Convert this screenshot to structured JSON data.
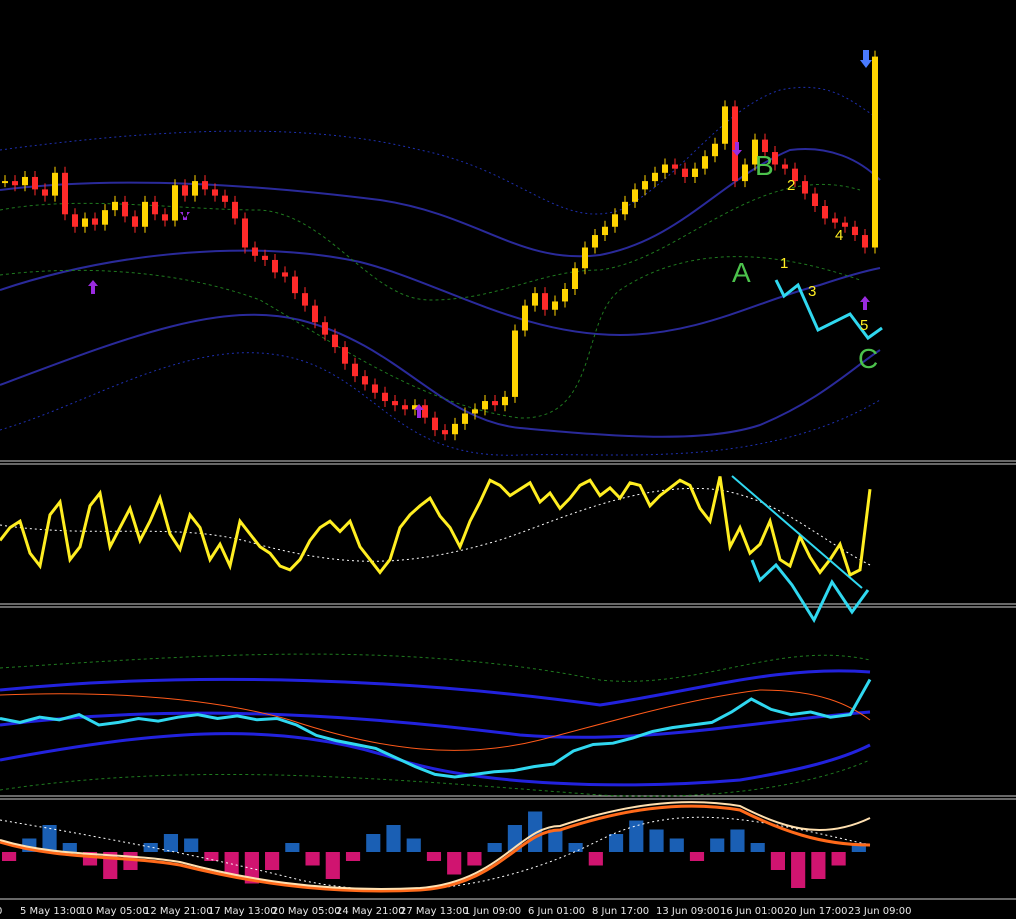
{
  "chart_data": [
    {
      "type": "candlestick",
      "panel": "price",
      "annotations": {
        "wave_letters": [
          "A",
          "B",
          "C"
        ],
        "wave_numbers": [
          "1",
          "2",
          "3",
          "4",
          "5"
        ]
      },
      "series": [
        {
          "name": "candles_close",
          "x": [
            0,
            10,
            20,
            30,
            40,
            50,
            60,
            70,
            80,
            90,
            100,
            110,
            120,
            130,
            140,
            150,
            160,
            170,
            180,
            190,
            200,
            210,
            220,
            230,
            240,
            250,
            260,
            270,
            280,
            290,
            300,
            310,
            320,
            330,
            340,
            350,
            360,
            370,
            380,
            390,
            400,
            410,
            420,
            430,
            440,
            450,
            460,
            470,
            480,
            490,
            500,
            510,
            520,
            530,
            540,
            550,
            560,
            570,
            580,
            590,
            600,
            610,
            620,
            630,
            640,
            650,
            660,
            670,
            680,
            690,
            700,
            710,
            720,
            730,
            740,
            750,
            760,
            770,
            780,
            790,
            800,
            810,
            820,
            830,
            840,
            850,
            860,
            870
          ],
          "y": [
            0.62,
            0.6,
            0.64,
            0.58,
            0.55,
            0.66,
            0.46,
            0.4,
            0.44,
            0.41,
            0.48,
            0.52,
            0.45,
            0.4,
            0.52,
            0.46,
            0.43,
            0.6,
            0.55,
            0.62,
            0.58,
            0.55,
            0.52,
            0.44,
            0.3,
            0.26,
            0.24,
            0.18,
            0.16,
            0.08,
            0.02,
            -0.06,
            -0.12,
            -0.18,
            -0.26,
            -0.32,
            -0.36,
            -0.4,
            -0.44,
            -0.46,
            -0.48,
            -0.46,
            -0.52,
            -0.58,
            -0.6,
            -0.55,
            -0.5,
            -0.48,
            -0.44,
            -0.46,
            -0.42,
            -0.1,
            0.02,
            0.08,
            0.0,
            0.04,
            0.1,
            0.2,
            0.3,
            0.36,
            0.4,
            0.46,
            0.52,
            0.58,
            0.62,
            0.66,
            0.7,
            0.68,
            0.64,
            0.68,
            0.74,
            0.8,
            0.98,
            0.62,
            0.7,
            0.82,
            0.76,
            0.7,
            0.68,
            0.62,
            0.56,
            0.5,
            0.44,
            0.42,
            0.4,
            0.36,
            0.3,
            1.22
          ]
        }
      ]
    },
    {
      "type": "line",
      "panel": "oscillator_1",
      "series": [
        {
          "name": "yellow",
          "y": [
            0.45,
            0.55,
            0.6,
            0.35,
            0.25,
            0.65,
            0.75,
            0.3,
            0.4,
            0.72,
            0.82,
            0.4,
            0.55,
            0.7,
            0.45,
            0.6,
            0.78,
            0.5,
            0.38,
            0.65,
            0.55,
            0.3,
            0.42,
            0.25,
            0.6,
            0.5,
            0.4,
            0.35,
            0.25,
            0.22,
            0.3,
            0.45,
            0.55,
            0.6,
            0.52,
            0.6,
            0.4,
            0.3,
            0.2,
            0.3,
            0.55,
            0.65,
            0.72,
            0.78,
            0.64,
            0.55,
            0.4,
            0.6,
            0.75,
            0.92,
            0.88,
            0.8,
            0.85,
            0.9,
            0.75,
            0.82,
            0.7,
            0.78,
            0.88,
            0.92,
            0.8,
            0.86,
            0.78,
            0.9,
            0.88,
            0.72,
            0.8,
            0.86,
            0.92,
            0.88,
            0.7,
            0.6,
            0.95,
            0.4,
            0.55,
            0.35,
            0.42,
            0.6,
            0.3,
            0.25,
            0.48,
            0.32,
            0.2,
            0.3,
            0.42,
            0.18,
            0.22,
            0.85
          ]
        }
      ]
    },
    {
      "type": "line",
      "panel": "oscillator_2",
      "series": [
        {
          "name": "cyan",
          "y": [
            0.55,
            0.52,
            0.56,
            0.54,
            0.58,
            0.5,
            0.52,
            0.55,
            0.53,
            0.56,
            0.58,
            0.55,
            0.57,
            0.54,
            0.55,
            0.5,
            0.42,
            0.38,
            0.35,
            0.32,
            0.25,
            0.18,
            0.12,
            0.1,
            0.12,
            0.14,
            0.15,
            0.18,
            0.2,
            0.3,
            0.35,
            0.36,
            0.4,
            0.45,
            0.48,
            0.5,
            0.52,
            0.6,
            0.7,
            0.62,
            0.58,
            0.6,
            0.56,
            0.58,
            0.85
          ]
        }
      ]
    },
    {
      "type": "bar",
      "panel": "histogram",
      "series": [
        {
          "name": "histogram",
          "values": [
            -0.2,
            0.3,
            0.6,
            0.2,
            -0.3,
            -0.6,
            -0.4,
            0.2,
            0.4,
            0.3,
            -0.2,
            -0.5,
            -0.7,
            -0.4,
            0.2,
            -0.3,
            -0.6,
            -0.2,
            0.4,
            0.6,
            0.3,
            -0.2,
            -0.5,
            -0.3,
            0.2,
            0.6,
            0.9,
            0.5,
            0.2,
            -0.3,
            0.4,
            0.7,
            0.5,
            0.3,
            -0.2,
            0.3,
            0.5,
            0.2,
            -0.4,
            -0.8,
            -0.6,
            -0.3,
            0.2
          ]
        }
      ]
    }
  ],
  "x_axis": {
    "labels": [
      "0",
      "5 May 13:00",
      "10 May 05:00",
      "12 May 21:00",
      "17 May 13:00",
      "20 May 05:00",
      "24 May 21:00",
      "27 May 13:00",
      "1 Jun 09:00",
      "6 Jun 01:00",
      "8 Jun 17:00",
      "13 Jun 09:00",
      "16 Jun 01:00",
      "20 Jun 17:00",
      "23 Jun 09:00"
    ]
  },
  "colors": {
    "background": "#000000",
    "bull_candle": "#ffd400",
    "bear_candle": "#ff2a2a",
    "band": "#2a2a8a",
    "dotted_band": "#1e2fb0",
    "green_dotted": "#1f7a1f",
    "yellow_line": "#ffee22",
    "cyan_line": "#30d8f0",
    "wave_letter": "#4cc24c",
    "wave_number": "#ffee22",
    "arrow": "#9a2be0",
    "hist_pos": "#1a5fb4",
    "hist_neg": "#d01470",
    "separator": "#cfcfcf"
  }
}
